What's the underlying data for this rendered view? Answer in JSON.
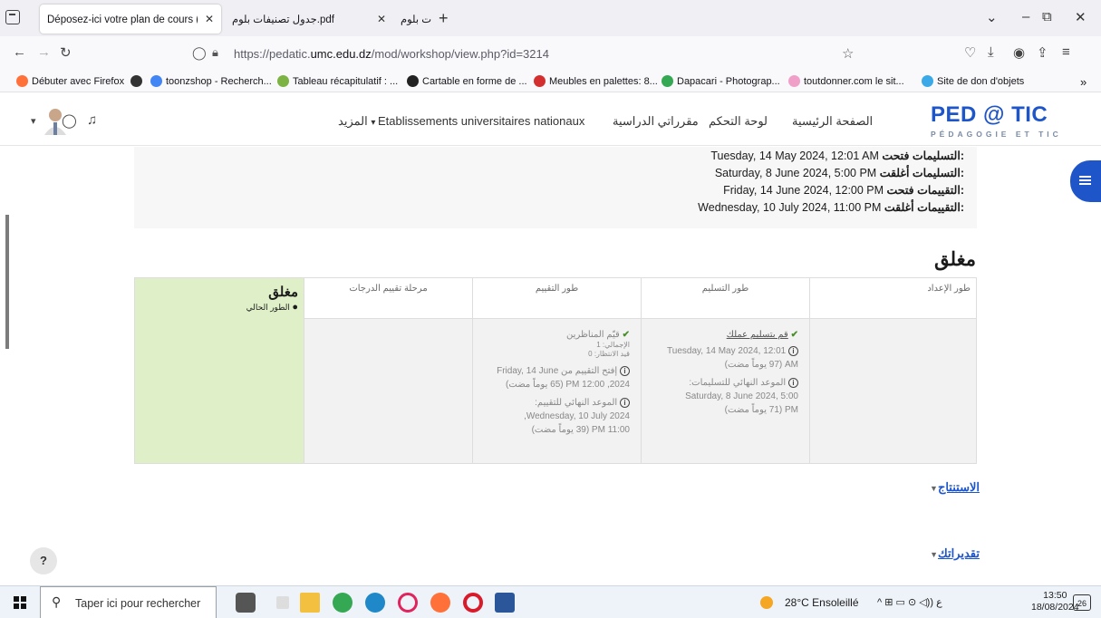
{
  "tabs": [
    {
      "title": "Déposez-ici votre plan de cours (تل",
      "active": true
    },
    {
      "title": "جدول تصنيفات بلوم.pdf",
      "active": false
    },
    {
      "title": "جدول تصنيفات بلوم.pdf",
      "active": false
    }
  ],
  "url": {
    "prefix": "https://pedatic.",
    "domain": "umc.edu.dz",
    "path": "/mod/workshop/view.php?id=3214"
  },
  "bookmarks": [
    {
      "label": "Débuter avec Firefox",
      "color": "#ff7139"
    },
    {
      "label": "toonzshop - Recherch...",
      "color": "#4285f4"
    },
    {
      "label": "Tableau récapitulatif : ...",
      "color": "#7cb342"
    },
    {
      "label": "Cartable en forme de ...",
      "color": "#222222"
    },
    {
      "label": "Meubles en palettes: 8...",
      "color": "#d32f2f"
    },
    {
      "label": "Dapacari - Photograp...",
      "color": "#34a853"
    },
    {
      "label": "toutdonner.com le sit...",
      "color": "#f0a0c8"
    },
    {
      "label": "Site de don d'objets",
      "color": "#3ba9e8"
    }
  ],
  "site": {
    "logo": "PED @ TIC",
    "logo_sub": "PÉDAGOGIE ET TIC",
    "menu": [
      "الصفحة الرئيسية",
      "لوحة التحكم",
      "مقرراتي الدراسية",
      "Etablissements universitaires nationaux",
      "المزيد"
    ]
  },
  "dates": [
    {
      "label": "التسليمات فتحت:",
      "value": "Tuesday, 14 May 2024, 12:01 AM"
    },
    {
      "label": "التسليمات أغلقت:",
      "value": "Saturday, 8 June 2024, 5:00 PM"
    },
    {
      "label": "التقييمات فتحت:",
      "value": "Friday, 14 June 2024, 12:00 PM"
    },
    {
      "label": "التقييمات أغلقت:",
      "value": "Wednesday, 10 July 2024, 11:00 PM"
    }
  ],
  "closed_title": "مغلق",
  "phases": {
    "setup": {
      "title": "طور الإعداد"
    },
    "submission": {
      "title": "طور التسليم",
      "task": "قم بتسليم عملك",
      "open_line1": "Tuesday, 14 May 2024, 12:01",
      "open_line2": "AM (97 يوماً مضت)",
      "deadline_label": "الموعد النهائي للتسليمات:",
      "deadline_line1": "Saturday, 8 June 2024, 5:00",
      "deadline_line2": "PM (71 يوماً مضت)"
    },
    "assessment": {
      "title": "طور التقييم",
      "task": "قيّم المناظرين",
      "total": "الإجمالي: 1",
      "pending": "قيد الانتظار: 0",
      "open_line1": "إفتح التقييم من Friday, 14 June",
      "open_line2": "2024, 12:00 PM (65 يوماً مضت)",
      "deadline_label": "الموعد النهائي للتقييم:",
      "deadline_line1": "Wednesday, 10 July 2024,",
      "deadline_line2": "11:00 PM (39 يوماً مضت)"
    },
    "grading": {
      "title": "مرحلة تقييم الدرجات"
    },
    "closed": {
      "title": "مغلق",
      "current_label": "الطور الحالي"
    }
  },
  "sections": [
    "الاستنتاج",
    "تقديراتك"
  ],
  "help": "?",
  "taskbar": {
    "search_placeholder": "Taper ici pour rechercher",
    "weather": "28°C Ensoleillé",
    "time": "13:50",
    "date": "18/08/2024",
    "notif_count": "26"
  }
}
